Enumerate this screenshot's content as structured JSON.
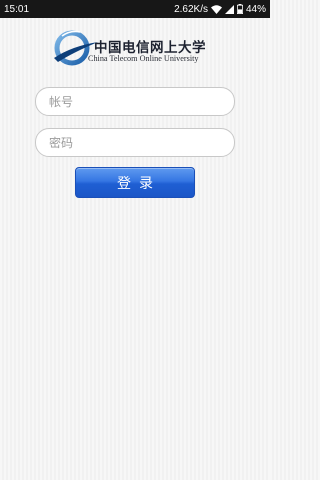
{
  "status_bar": {
    "time": "15:01",
    "network_speed": "2.62K/s",
    "battery": "44%",
    "icons": [
      "wifi-icon",
      "signal-icon",
      "battery-icon"
    ]
  },
  "logo": {
    "title_cn": "中国电信网上大学",
    "subtitle_en": "China Telecom Online University",
    "icon": "swoosh-logo"
  },
  "form": {
    "username_placeholder": "帐号",
    "password_placeholder": "密码",
    "login_label": "登录"
  },
  "colors": {
    "button": "#2a6ada",
    "status_bar": "#171717",
    "field_border": "#c8c8c8"
  }
}
